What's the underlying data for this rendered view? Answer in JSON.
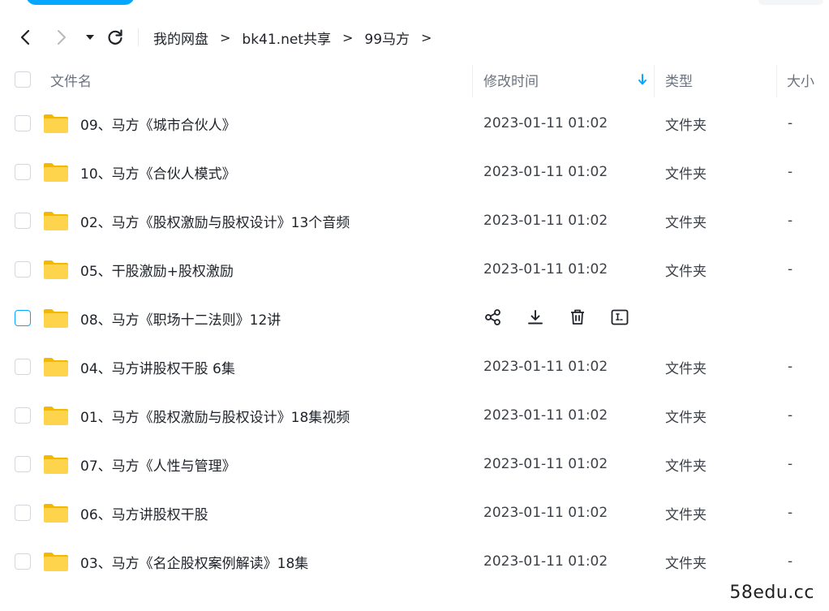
{
  "nav": {
    "breadcrumbs": [
      "我的网盘",
      "bk41.net共享",
      "99马方"
    ],
    "separator": ">"
  },
  "header": {
    "name": "文件名",
    "time": "修改时间",
    "type": "类型",
    "size": "大小",
    "sort_icon": "arrow-down-icon"
  },
  "rows": [
    {
      "name": "09、马方《城市合伙人》",
      "time": "2023-01-11 01:02",
      "type": "文件夹",
      "size": "-"
    },
    {
      "name": "10、马方《合伙人模式》",
      "time": "2023-01-11 01:02",
      "type": "文件夹",
      "size": "-"
    },
    {
      "name": "02、马方《股权激励与股权设计》13个音频",
      "time": "2023-01-11 01:02",
      "type": "文件夹",
      "size": "-"
    },
    {
      "name": "05、干股激励+股权激励",
      "time": "2023-01-11 01:02",
      "type": "文件夹",
      "size": "-"
    },
    {
      "name": "08、马方《职场十二法则》12讲",
      "time": "",
      "type": "",
      "size": "",
      "hovered": true,
      "actions": [
        "share-icon",
        "download-icon",
        "delete-icon",
        "rename-icon"
      ]
    },
    {
      "name": "04、马方讲股权干股 6集",
      "time": "2023-01-11 01:02",
      "type": "文件夹",
      "size": "-"
    },
    {
      "name": "01、马方《股权激励与股权设计》18集视频",
      "time": "2023-01-11 01:02",
      "type": "文件夹",
      "size": "-"
    },
    {
      "name": "07、马方《人性与管理》",
      "time": "2023-01-11 01:02",
      "type": "文件夹",
      "size": "-"
    },
    {
      "name": "06、马方讲股权干股",
      "time": "2023-01-11 01:02",
      "type": "文件夹",
      "size": "-"
    },
    {
      "name": "03、马方《名企股权案例解读》18集",
      "time": "2023-01-11 01:02",
      "type": "文件夹",
      "size": "-"
    }
  ],
  "watermark": "58edu.cc",
  "colors": {
    "accent": "#06a7ff",
    "folder": "#ffd44d",
    "folder_tab": "#f5b800"
  }
}
